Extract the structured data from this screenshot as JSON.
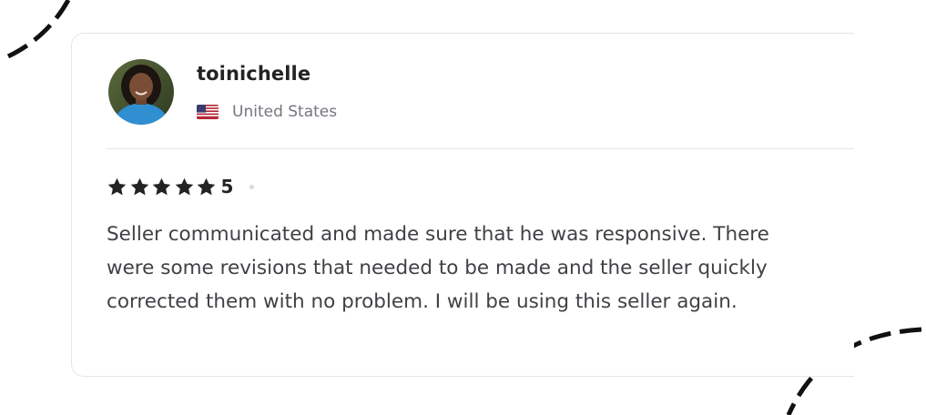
{
  "review": {
    "username": "toinichelle",
    "country": "United States",
    "country_flag_icon": "us-flag-icon",
    "rating": {
      "value": "5",
      "stars_filled": 5,
      "stars_total": 5
    },
    "text": "Seller communicated and made sure that he was responsive. There were some revisions that needed to be made and the seller quickly corrected them with no problem. I will be using this seller again."
  },
  "colors": {
    "text_primary": "#222325",
    "text_body": "#404145",
    "text_muted": "#74767e",
    "border": "#e4e5e7",
    "decoration": "#111111"
  }
}
